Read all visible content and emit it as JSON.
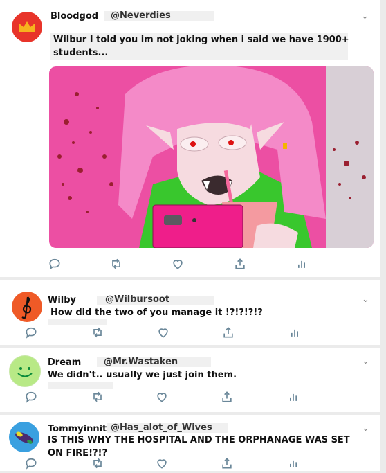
{
  "posts": [
    {
      "name": "Bloodgod",
      "handle": "@Neverdies",
      "text": "Wilbur I told you im not joking when i said we have 1900+ students...",
      "avatar_color": "#e8342a",
      "avatar_icon": "crown-icon",
      "has_image": true
    },
    {
      "name": "Wilby",
      "handle": "@Wilbursoot",
      "text": "How did the two of you manage it !?!?!?!?",
      "avatar_color": "#ef5a27",
      "avatar_icon": "treble-clef-icon"
    },
    {
      "name": "Dream",
      "handle": "@Mr.Wastaken",
      "text": "We didn't.. usually we just join them.",
      "avatar_color": "#b8e986",
      "avatar_icon": "smiley-icon"
    },
    {
      "name": "Tommyinnit",
      "handle": "@Has_alot_of_Wives",
      "text": "IS THIS WHY THE HOSPITAL AND THE ORPHANAGE WAS SET ON FIRE!?!?",
      "avatar_color": "#3aa0e0",
      "avatar_icon": "disc-icon"
    }
  ],
  "action_icons": [
    "reply-icon",
    "retweet-icon",
    "like-icon",
    "share-icon",
    "analytics-icon"
  ],
  "colors": {
    "icon_gray": "#6a8799",
    "background": "#ebebeb",
    "card": "#ffffff"
  }
}
